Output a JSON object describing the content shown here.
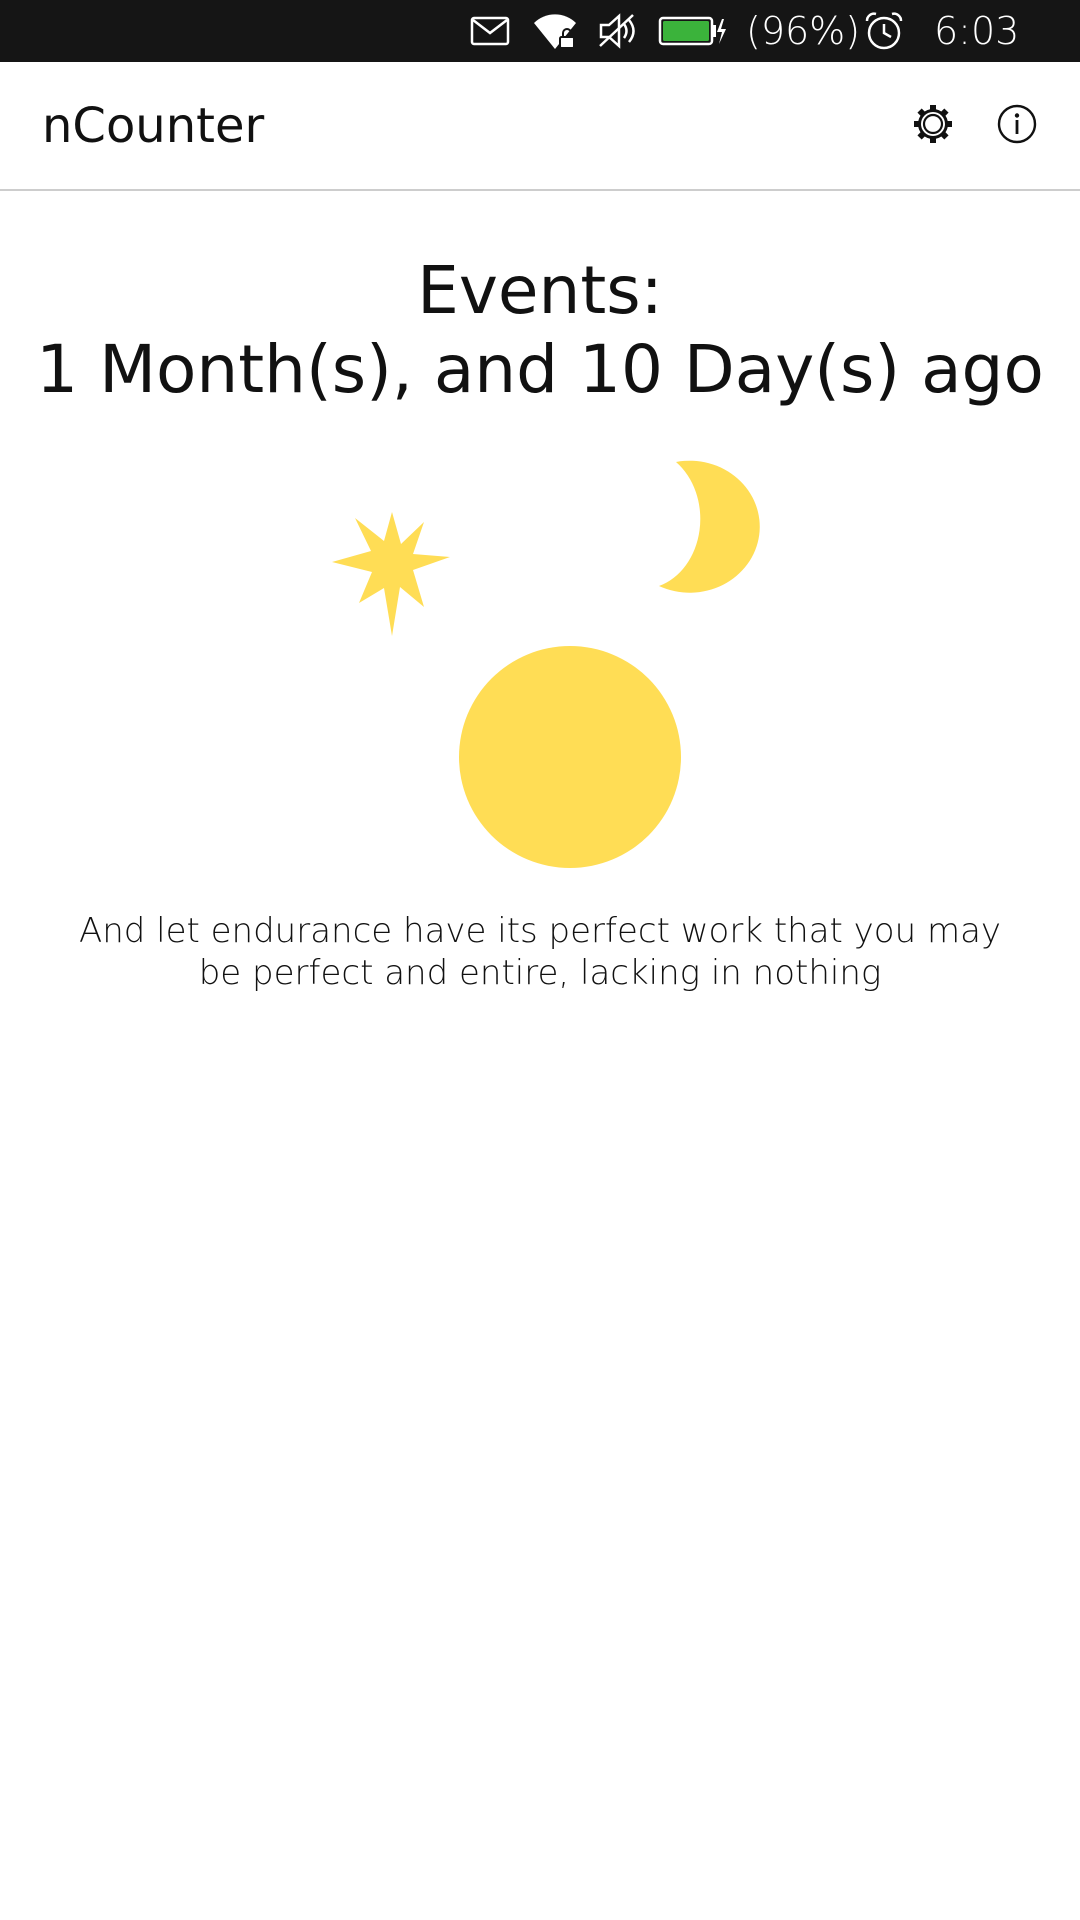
{
  "status_bar": {
    "battery_text": "(96%)",
    "time": "6:03 AM",
    "icons": [
      "mail-icon",
      "wifi-lock-icon",
      "volume-muted-icon",
      "battery-charging-icon",
      "alarm-clock-icon"
    ]
  },
  "header": {
    "title": "nCounter",
    "icons": [
      "gear-icon",
      "info-icon"
    ]
  },
  "main": {
    "events_label": "Events:",
    "elapsed": "1 Month(s), and 10 Day(s) ago",
    "quote": "And let endurance have its perfect work that you may be perfect and entire, lacking in nothing"
  },
  "colors": {
    "accent_yellow": "#FFDD55",
    "status_bar_bg": "#151515",
    "battery_green": "#3BB33B"
  }
}
